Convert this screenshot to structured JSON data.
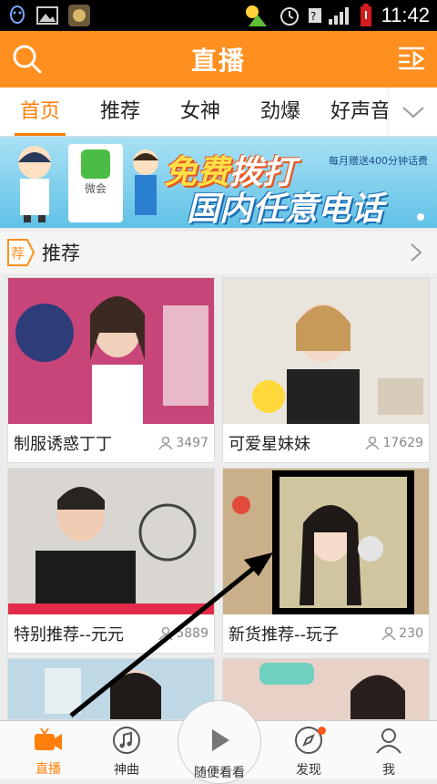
{
  "status_bar": {
    "time": "11:42",
    "icons": [
      "qq-icon",
      "gallery-icon",
      "app-icon",
      "weather-icon",
      "alarm-icon",
      "signal-icon",
      "battery-icon"
    ]
  },
  "app_bar": {
    "title": "直播",
    "left_icon": "search-icon",
    "right_icon": "menu-play-icon"
  },
  "tabs": {
    "items": [
      {
        "label": "首页",
        "active": true
      },
      {
        "label": "推荐",
        "active": false
      },
      {
        "label": "女神",
        "active": false
      },
      {
        "label": "劲爆",
        "active": false
      },
      {
        "label": "好声音",
        "active": false
      }
    ],
    "more_icon": "chevron-down-icon"
  },
  "banner": {
    "app_name": "微会",
    "headline_a": "免费",
    "headline_b": "拨打",
    "headline_line2": "国内任意电话",
    "note": "每月赠送400分钟话费"
  },
  "section": {
    "title": "推荐",
    "icon": "recommend-icon"
  },
  "cards": [
    {
      "title": "制服诱惑丁丁",
      "viewers": "3497",
      "thumb_color": "#c8457a"
    },
    {
      "title": "可爱星妹妹",
      "viewers": "17629",
      "thumb_color": "#e9e4dc"
    },
    {
      "title": "特别推荐--元元",
      "viewers": "5889",
      "thumb_color": "#d9d6d2"
    },
    {
      "title": "新货推荐--玩子",
      "viewers": "230",
      "thumb_color": "#c9b08a"
    },
    {
      "title": "",
      "viewers": "",
      "thumb_color": "#bfd8e6"
    },
    {
      "title": "",
      "viewers": "",
      "thumb_color": "#e8d2c8"
    }
  ],
  "bottom_nav": {
    "items": [
      {
        "label": "直播",
        "icon": "live-icon",
        "active": true
      },
      {
        "label": "神曲",
        "icon": "music-icon",
        "active": false
      },
      {
        "label": "随便看看",
        "icon": "play-icon",
        "active": false
      },
      {
        "label": "发现",
        "icon": "compass-icon",
        "active": false
      },
      {
        "label": "我",
        "icon": "user-icon",
        "active": false
      }
    ]
  },
  "colors": {
    "accent": "#ff8f1e",
    "tab_active": "#ff7f0a",
    "status_bg": "#000000"
  }
}
